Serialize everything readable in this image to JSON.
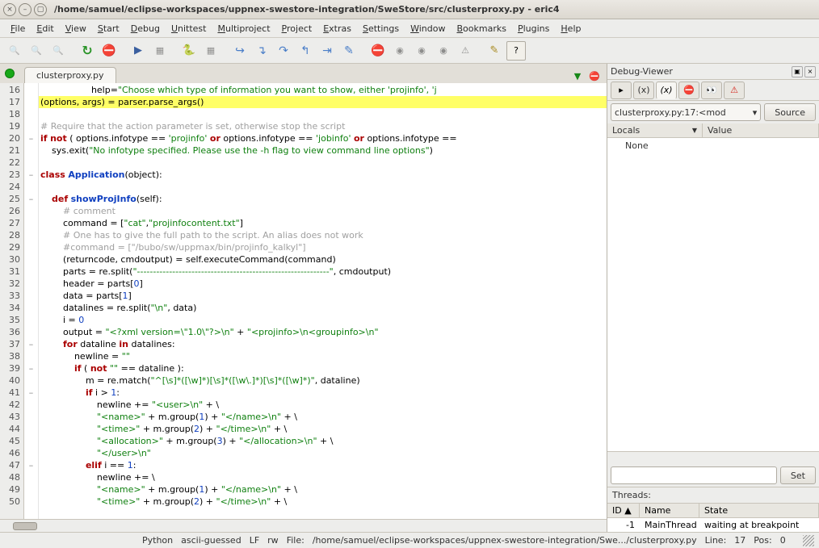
{
  "window": {
    "title": "/home/samuel/eclipse-workspaces/uppnex-swestore-integration/SweStore/src/clusterproxy.py - eric4",
    "btn_close": "×",
    "btn_min": "–",
    "btn_max": "▢"
  },
  "menus": [
    "File",
    "Edit",
    "View",
    "Start",
    "Debug",
    "Unittest",
    "Multiproject",
    "Project",
    "Extras",
    "Settings",
    "Window",
    "Bookmarks",
    "Plugins",
    "Help"
  ],
  "tabs": {
    "active": "clusterproxy.py"
  },
  "debug_viewer": {
    "title": "Debug-Viewer",
    "frame_combo": "clusterproxy.py:17:<mod",
    "source_btn": "Source",
    "cols": {
      "locals": "Locals",
      "value": "Value"
    },
    "locals": [
      {
        "name": "None",
        "value": ""
      }
    ],
    "set_btn": "Set",
    "threads_label": "Threads:",
    "thread_cols": {
      "id": "ID",
      "name": "Name",
      "state": "State"
    },
    "threads": [
      {
        "id": "-1",
        "name": "MainThread",
        "state": "waiting at breakpoint"
      }
    ]
  },
  "status": {
    "lang": "Python",
    "enc": "ascii-guessed",
    "eol": "LF",
    "mode": "rw",
    "file_label": "File:",
    "file": "/home/samuel/eclipse-workspaces/uppnex-swestore-integration/Swe.../clusterproxy.py",
    "line_label": "Line:",
    "line": "17",
    "pos_label": "Pos:",
    "pos": "0"
  },
  "code": {
    "first_line": 16,
    "lines": [
      {
        "n": 16,
        "fold": "",
        "html": "                  help=<span class='st'>\"Choose which type of information you want to show, either 'projinfo', 'j</span>"
      },
      {
        "n": 17,
        "fold": "",
        "hl": true,
        "html": "<span class='op'>(</span>options, args<span class='op'>)</span> = parser.parse_args<span class='op'>()</span>"
      },
      {
        "n": 18,
        "fold": "",
        "html": ""
      },
      {
        "n": 19,
        "fold": "",
        "html": "<span class='cm'># Require that the action parameter is set, otherwise stop the script</span>"
      },
      {
        "n": 20,
        "fold": "–",
        "html": "<span class='kw'>if</span> <span class='kw'>not</span> <span class='op'>(</span> options.infotype == <span class='st'>'projinfo'</span> <span class='kw'>or</span> options.infotype == <span class='st'>'jobinfo'</span> <span class='kw'>or</span> options.infotype =="
      },
      {
        "n": 21,
        "fold": "",
        "html": "    sys.exit(<span class='st'>\"No infotype specified. Please use the -h flag to view command line options\"</span>)"
      },
      {
        "n": 22,
        "fold": "",
        "html": ""
      },
      {
        "n": 23,
        "fold": "–",
        "html": "<span class='kw'>class</span> <span class='df'>Application</span><span class='op'>(</span>object<span class='op'>)</span>:"
      },
      {
        "n": 24,
        "fold": "",
        "html": ""
      },
      {
        "n": 25,
        "fold": "–",
        "html": "    <span class='kw'>def</span> <span class='df'>showProjInfo</span><span class='op'>(</span>self<span class='op'>)</span>:"
      },
      {
        "n": 26,
        "fold": "",
        "html": "        <span class='cm'># comment</span>"
      },
      {
        "n": 27,
        "fold": "",
        "html": "        command = [<span class='st'>\"cat\"</span>,<span class='st'>\"projinfocontent.txt\"</span>]"
      },
      {
        "n": 28,
        "fold": "",
        "html": "        <span class='cm'># One has to give the full path to the script. An alias does not work</span>"
      },
      {
        "n": 29,
        "fold": "",
        "html": "        <span class='cm'>#command = [\"/bubo/sw/uppmax/bin/projinfo_kalkyl\"]</span>"
      },
      {
        "n": 30,
        "fold": "",
        "html": "        <span class='op'>(</span>returncode, cmdoutput<span class='op'>)</span> = self.executeCommand<span class='op'>(</span>command<span class='op'>)</span>"
      },
      {
        "n": 31,
        "fold": "",
        "html": "        parts = re.split(<span class='st'>\"------------------------------------------------------------\"</span>, cmdoutput)"
      },
      {
        "n": 32,
        "fold": "",
        "html": "        header = parts[<span class='num'>0</span>]"
      },
      {
        "n": 33,
        "fold": "",
        "html": "        data = parts[<span class='num'>1</span>]"
      },
      {
        "n": 34,
        "fold": "",
        "html": "        datalines = re.split(<span class='st'>\"\\n\"</span>, data)"
      },
      {
        "n": 35,
        "fold": "",
        "html": "        i = <span class='num'>0</span>"
      },
      {
        "n": 36,
        "fold": "",
        "html": "        output = <span class='st'>\"&lt;?xml version=\\\"1.0\\\"?&gt;\\n\"</span> + <span class='st'>\"&lt;projinfo&gt;\\n&lt;groupinfo&gt;\\n\"</span>"
      },
      {
        "n": 37,
        "fold": "–",
        "html": "        <span class='kw'>for</span> dataline <span class='kw'>in</span> datalines:"
      },
      {
        "n": 38,
        "fold": "",
        "html": "            newline = <span class='st'>\"\"</span>"
      },
      {
        "n": 39,
        "fold": "–",
        "html": "            <span class='kw'>if</span> <span class='op'>(</span> <span class='kw'>not</span> <span class='st'>\"\"</span> == dataline <span class='op'>)</span>:"
      },
      {
        "n": 40,
        "fold": "",
        "html": "                m = re.match(<span class='st'>\"^[\\s]*([\\w]*)[\\s]*([\\w\\.]*)[\\s]*([\\w]*)\"</span>, dataline)"
      },
      {
        "n": 41,
        "fold": "–",
        "html": "                <span class='kw'>if</span> i &gt; <span class='num'>1</span>:"
      },
      {
        "n": 42,
        "fold": "",
        "html": "                    newline += <span class='st'>\"&lt;user&gt;\\n\"</span> + \\"
      },
      {
        "n": 43,
        "fold": "",
        "html": "                    <span class='st'>\"&lt;name&gt;\"</span> + m.group(<span class='num'>1</span>) + <span class='st'>\"&lt;/name&gt;\\n\"</span> + \\"
      },
      {
        "n": 44,
        "fold": "",
        "html": "                    <span class='st'>\"&lt;time&gt;\"</span> + m.group(<span class='num'>2</span>) + <span class='st'>\"&lt;/time&gt;\\n\"</span> + \\"
      },
      {
        "n": 45,
        "fold": "",
        "html": "                    <span class='st'>\"&lt;allocation&gt;\"</span> + m.group(<span class='num'>3</span>) + <span class='st'>\"&lt;/allocation&gt;\\n\"</span> + \\"
      },
      {
        "n": 46,
        "fold": "",
        "html": "                    <span class='st'>\"&lt;/user&gt;\\n\"</span>"
      },
      {
        "n": 47,
        "fold": "–",
        "html": "                <span class='kw'>elif</span> i == <span class='num'>1</span>:"
      },
      {
        "n": 48,
        "fold": "",
        "html": "                    newline += \\"
      },
      {
        "n": 49,
        "fold": "",
        "html": "                    <span class='st'>\"&lt;name&gt;\"</span> + m.group(<span class='num'>1</span>) + <span class='st'>\"&lt;/name&gt;\\n\"</span> + \\"
      },
      {
        "n": 50,
        "fold": "",
        "html": "                    <span class='st'>\"&lt;time&gt;\"</span> + m.group(<span class='num'>2</span>) + <span class='st'>\"&lt;/time&gt;\\n\"</span> + \\"
      }
    ]
  }
}
